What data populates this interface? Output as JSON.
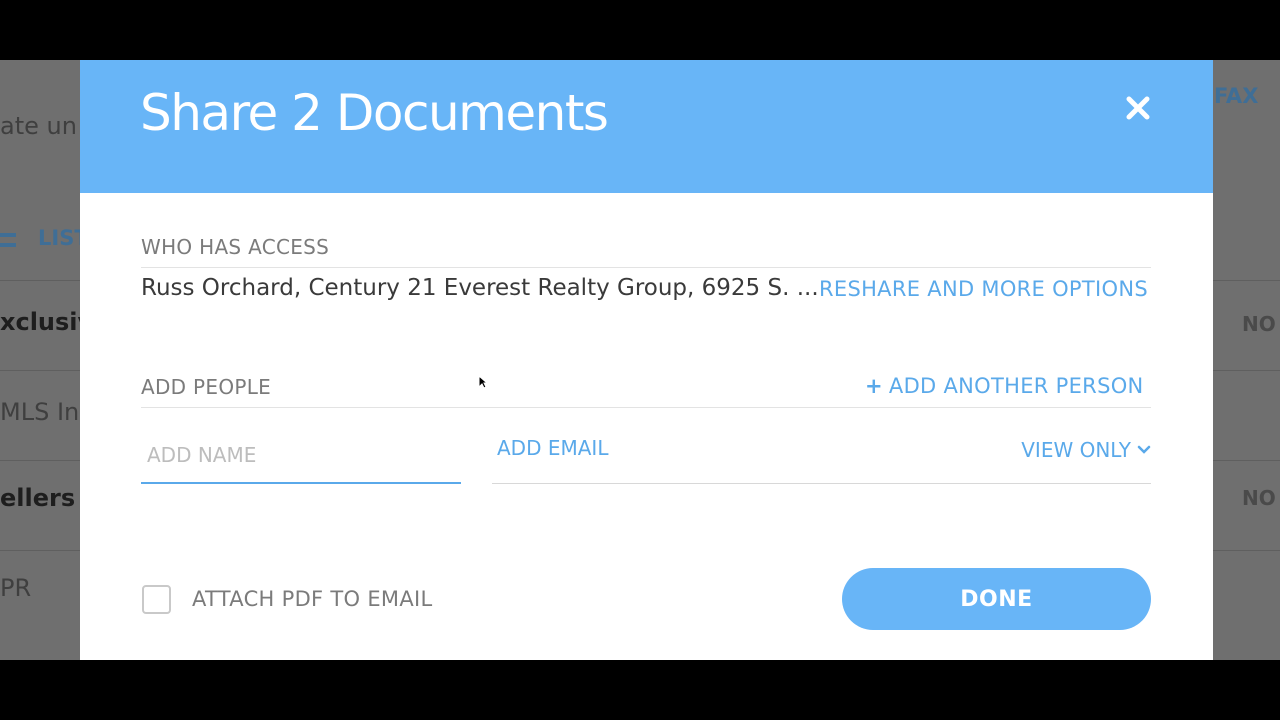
{
  "background": {
    "texts": [
      "ate un",
      "FAX",
      "LIST",
      "xclusiv",
      "NO",
      "MLS Inp",
      "ellers",
      "NO",
      "PR"
    ]
  },
  "modal": {
    "title": "Share 2 Documents",
    "who_has_access": {
      "label": "WHO HAS ACCESS",
      "people": "Russ Orchard, Century 21 Everest Realty Group, 6925 S. ...",
      "reshare_link": "RESHARE AND MORE OPTIONS"
    },
    "add_people": {
      "label": "ADD PEOPLE",
      "add_another": "ADD ANOTHER PERSON",
      "name_placeholder": "ADD NAME",
      "name_value": "",
      "email_placeholder": "ADD EMAIL",
      "permission": "VIEW ONLY"
    },
    "attach_pdf": {
      "label": "ATTACH PDF TO EMAIL",
      "checked": false
    },
    "done_label": "DONE"
  },
  "colors": {
    "accent": "#68b5f7",
    "link": "#5aa9ea"
  }
}
